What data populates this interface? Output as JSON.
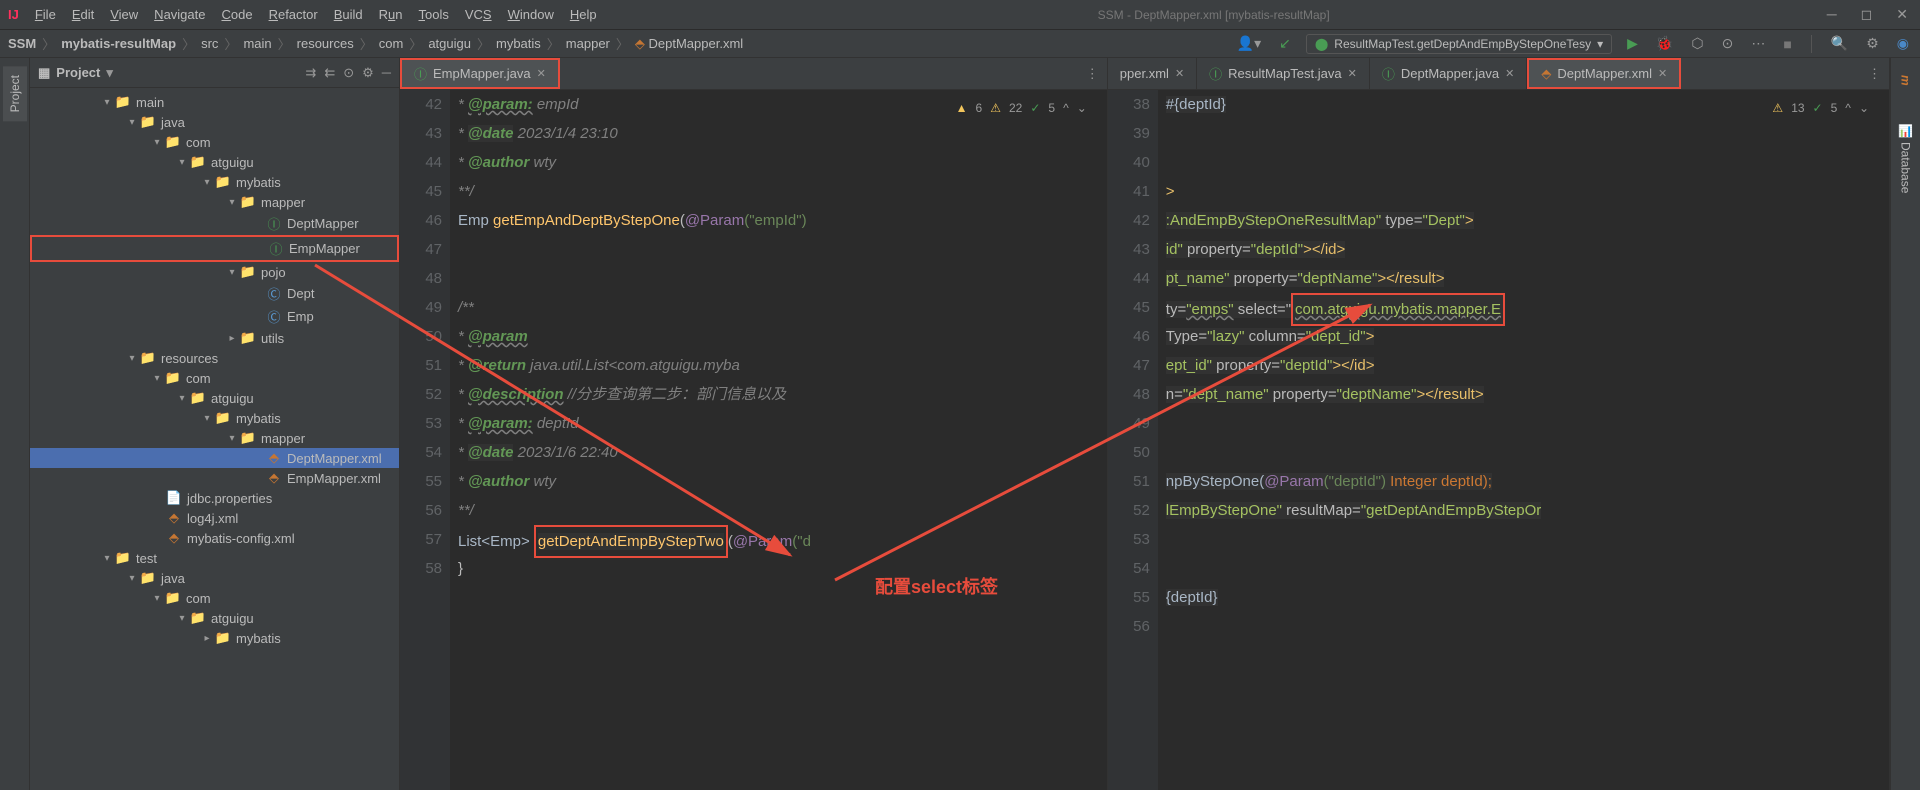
{
  "window": {
    "title": "SSM - DeptMapper.xml [mybatis-resultMap]"
  },
  "menu": {
    "file": "File",
    "edit": "Edit",
    "view": "View",
    "navigate": "Navigate",
    "code": "Code",
    "refactor": "Refactor",
    "build": "Build",
    "run": "Run",
    "tools": "Tools",
    "vcs": "VCS",
    "window": "Window",
    "help": "Help"
  },
  "breadcrumb": {
    "project": "SSM",
    "module": "mybatis-resultMap",
    "parts": [
      "src",
      "main",
      "resources",
      "com",
      "atguigu",
      "mybatis",
      "mapper"
    ],
    "file": "DeptMapper.xml"
  },
  "run_config": "ResultMapTest.getDeptAndEmpByStepOneTesy",
  "project_panel": {
    "title": "Project"
  },
  "tree": {
    "main": "main",
    "java": "java",
    "com": "com",
    "atguigu": "atguigu",
    "mybatis": "mybatis",
    "mapper": "mapper",
    "deptMapper": "DeptMapper",
    "empMapper": "EmpMapper",
    "pojo": "pojo",
    "dept": "Dept",
    "emp": "Emp",
    "utils": "utils",
    "resources": "resources",
    "deptMapperXml": "DeptMapper.xml",
    "empMapperXml": "EmpMapper.xml",
    "jdbc": "jdbc.properties",
    "log4j": "log4j.xml",
    "mybatisConfig": "mybatis-config.xml",
    "test": "test"
  },
  "editor_left": {
    "tab": "EmpMapper.java",
    "inspection": {
      "warn_a": "6",
      "warn_b": "22",
      "check": "5"
    },
    "lines": [
      "42",
      "43",
      "44",
      "45",
      "46",
      "47",
      "48",
      "49",
      "50",
      "51",
      "52",
      "53",
      "54",
      "55",
      "56",
      "57",
      "58"
    ],
    "code": {
      "l42": " * @param: empId",
      "l43_tag": "@date",
      "l43_rest": " 2023/1/4 23:10",
      "l44_tag": "@author",
      "l44_rest": " wty",
      "l45": "**/",
      "l46_ret": "Emp ",
      "l46_fn": "getEmpAndDeptByStepOne",
      "l46_paren": "(",
      "l46_anno": "@Param",
      "l46_rest": "(\"empId\")",
      "l49": "/**",
      "l50": " * @param",
      "l51_tag": "@return",
      "l51_rest": " java.util.List<com.atguigu.myba",
      "l52_tag": "@description",
      "l52_rest": " //分步查询第二步：部门信息以及",
      "l53_tag": "@param:",
      "l53_rest": " deptId",
      "l54_tag": "@date",
      "l54_rest": " 2023/1/6 22:40",
      "l55_tag": "@author",
      "l55_rest": " wty",
      "l56": "**/",
      "l57_pre": "List<Emp> ",
      "l57_fn": "getDeptAndEmpByStepTwo",
      "l57_post_a": "(",
      "l57_anno": "@Param",
      "l57_post_b": "(\"d",
      "l58": "}"
    }
  },
  "editor_right": {
    "tabs": {
      "t1": "pper.xml",
      "t2": "ResultMapTest.java",
      "t3": "DeptMapper.java",
      "t4": "DeptMapper.xml"
    },
    "inspection": {
      "warn": "13",
      "check": "5"
    },
    "lines": [
      "38",
      "39",
      "40",
      "41",
      "42",
      "43",
      "44",
      "45",
      "46",
      "47",
      "48",
      "49",
      "50",
      "51",
      "52",
      "53",
      "54",
      "55",
      "56"
    ],
    "code": {
      "l38": "#{deptId}",
      "l41": ">",
      "l42_a": ":AndEmpByStepOneResultMap\"",
      "l42_b": " type=",
      "l42_c": "\"Dept\"",
      "l42_d": ">",
      "l43_a": "id\"",
      "l43_b": " property=",
      "l43_c": "\"deptId\"",
      "l43_d": "></",
      "l43_e": "id",
      "l43_f": ">",
      "l44_a": "pt_name\"",
      "l44_b": " property=",
      "l44_c": "\"deptName\"",
      "l44_d": "></",
      "l44_e": "result",
      "l44_f": ">",
      "l45_a": "ty=",
      "l45_b": "\"emps\"",
      "l45_c": " select=\"",
      "l45_d": "com.atguigu.mybatis.mapper.E",
      "l46_a": "Type=",
      "l46_b": "\"lazy\"",
      "l46_c": " column=",
      "l46_d": "\"dept_id\"",
      "l46_e": ">",
      "l47_a": "ept_id\"",
      "l47_b": " property=",
      "l47_c": "\"deptId\"",
      "l47_d": "></",
      "l47_e": "id",
      "l47_f": ">",
      "l48_a": "n=",
      "l48_b": "\"dept_name\"",
      "l48_c": " property=",
      "l48_d": "\"deptName\"",
      "l48_e": "></",
      "l48_f": "result",
      "l48_g": ">",
      "l51_a": "npByStepOne(",
      "l51_b": "@Param",
      "l51_c": "(\"deptId\")",
      "l51_d": " Integer deptId);",
      "l52_a": "lEmpByStepOne\"",
      "l52_b": " resultMap=",
      "l52_c": "\"getDeptAndEmpByStepOr",
      "l55": "{deptId}"
    }
  },
  "annotations": {
    "select_label": "配置select标签"
  },
  "sidebar_right": {
    "maven": "m",
    "database": "Database"
  }
}
